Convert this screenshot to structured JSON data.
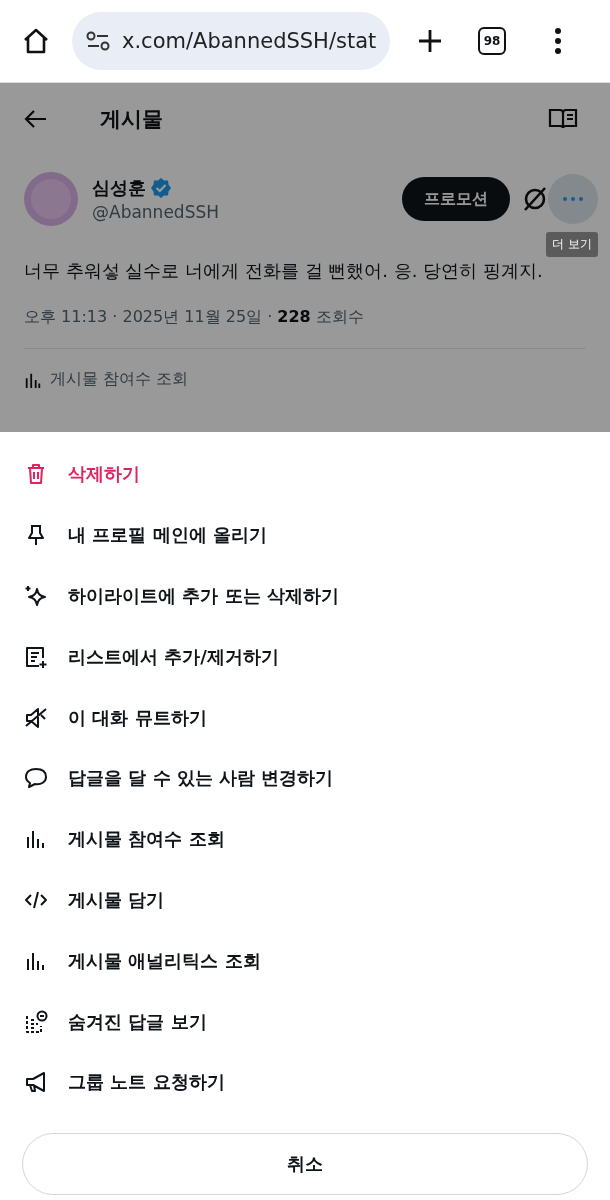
{
  "browser": {
    "url": "x.com/AbannedSSH/stat",
    "tab_count": "98"
  },
  "header": {
    "title": "게시물"
  },
  "post": {
    "name": "심성훈",
    "verified": true,
    "handle": "@AbannedSSH",
    "promote_button": "프로모션",
    "more_tooltip": "더 보기",
    "text": "너무 추워섷 실수로 너에게 전화를 걸 뻔했어. 응. 당연히 핑계지.",
    "meta": "오후 11:13 · 2025년 11월 25일 · **228** 조회수",
    "engagements_link": "게시물 참여수 조회"
  },
  "menu": {
    "items": [
      {
        "label": "삭제하기",
        "kind": "trash",
        "danger": true
      },
      {
        "label": "내 프로필 메인에 올리기",
        "kind": "pin",
        "danger": false
      },
      {
        "label": "하이라이트에 추가 또는 삭제하기",
        "kind": "sparkle",
        "danger": false
      },
      {
        "label": "리스트에서 추가/제거하기",
        "kind": "list",
        "danger": false
      },
      {
        "label": "이 대화 뮤트하기",
        "kind": "mute",
        "danger": false
      },
      {
        "label": "답글을 달 수 있는 사람 변경하기",
        "kind": "reply",
        "danger": false
      },
      {
        "label": "게시물 참여수 조회",
        "kind": "stats",
        "danger": false
      },
      {
        "label": "게시물 담기",
        "kind": "embed",
        "danger": false
      },
      {
        "label": "게시물 애널리틱스 조회",
        "kind": "stats",
        "danger": false
      },
      {
        "label": "숨겨진 답글 보기",
        "kind": "hidden",
        "danger": false
      },
      {
        "label": "그룹 노트 요청하기",
        "kind": "note",
        "danger": false
      }
    ],
    "cancel_button": "취소"
  }
}
